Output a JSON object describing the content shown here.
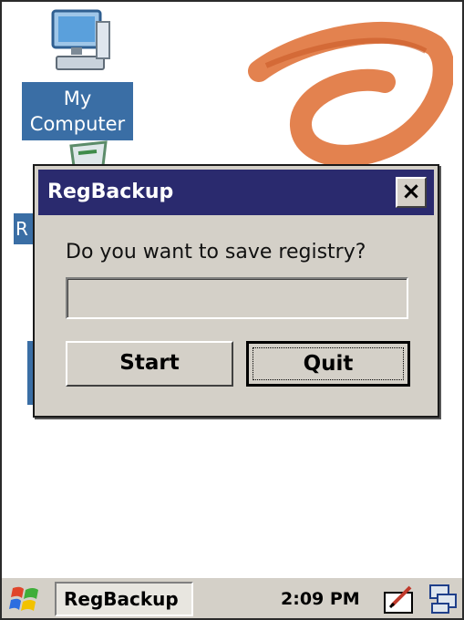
{
  "desktop": {
    "icons": [
      {
        "label": "My\nComputer",
        "icon": "computer-icon"
      }
    ],
    "edge_label": "R"
  },
  "dialog": {
    "title": "RegBackup",
    "close_label": "×",
    "prompt": "Do you want to save registry?",
    "progress_value": "",
    "start_label": "Start",
    "quit_label": "Quit"
  },
  "taskbar": {
    "app_label": "RegBackup",
    "clock": "2:09 PM"
  },
  "colors": {
    "titlebar": "#2a2a6e",
    "selection": "#3a6ea5",
    "logo": "#e0743c",
    "chrome": "#d4d0c8"
  }
}
